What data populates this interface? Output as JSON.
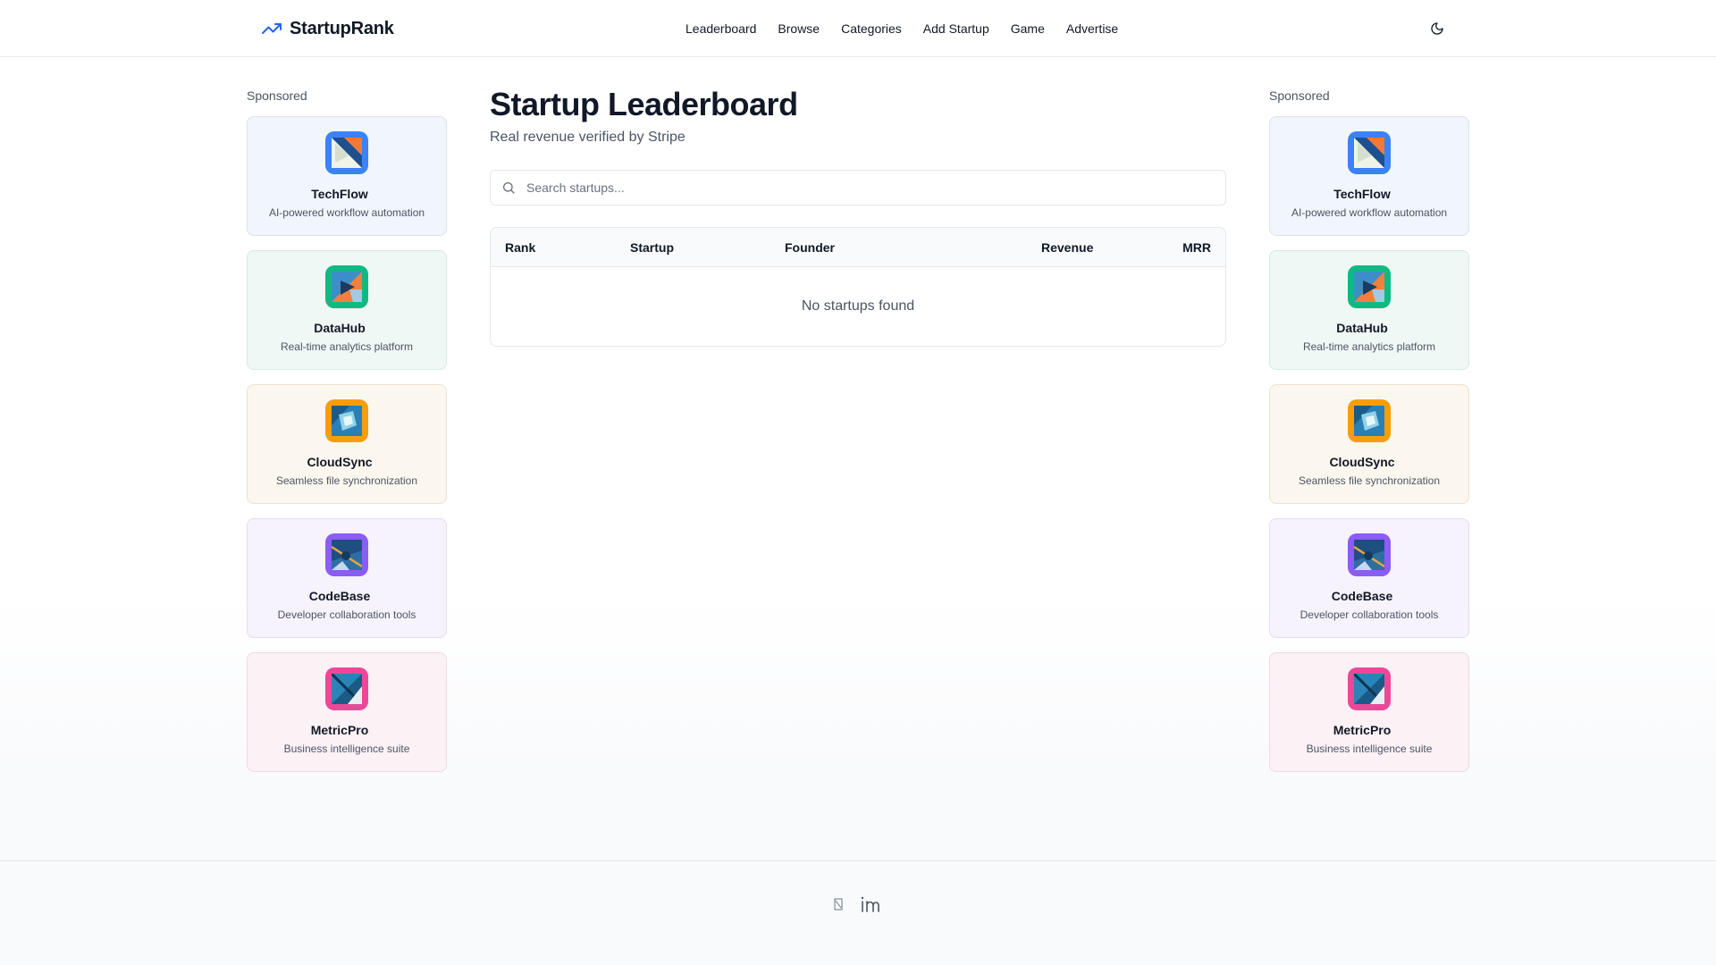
{
  "header": {
    "logo_text": "StartupRank",
    "nav": [
      "Leaderboard",
      "Browse",
      "Categories",
      "Add Startup",
      "Game",
      "Advertise"
    ]
  },
  "sidebar_left": {
    "label": "Sponsored",
    "ads": [
      {
        "name": "TechFlow",
        "desc": "AI-powered workflow automation",
        "icon_color": "#3b82f6"
      },
      {
        "name": "DataHub",
        "desc": "Real-time analytics platform",
        "icon_color": "#10b981"
      },
      {
        "name": "CloudSync",
        "desc": "Seamless file synchronization",
        "icon_color": "#f59e0b"
      },
      {
        "name": "CodeBase",
        "desc": "Developer collaboration tools",
        "icon_color": "#8b5cf6"
      },
      {
        "name": "MetricPro",
        "desc": "Business intelligence suite",
        "icon_color": "#ec4899"
      }
    ]
  },
  "sidebar_right": {
    "label": "Sponsored",
    "ads": [
      {
        "name": "TechFlow",
        "desc": "AI-powered workflow automation",
        "icon_color": "#3b82f6"
      },
      {
        "name": "DataHub",
        "desc": "Real-time analytics platform",
        "icon_color": "#10b981"
      },
      {
        "name": "CloudSync",
        "desc": "Seamless file synchronization",
        "icon_color": "#f59e0b"
      },
      {
        "name": "CodeBase",
        "desc": "Developer collaboration tools",
        "icon_color": "#8b5cf6"
      },
      {
        "name": "MetricPro",
        "desc": "Business intelligence suite",
        "icon_color": "#ec4899"
      }
    ]
  },
  "main": {
    "title": "Startup Leaderboard",
    "subtitle": "Real revenue verified by Stripe",
    "search_placeholder": "Search startups...",
    "table": {
      "columns": [
        "Rank",
        "Startup",
        "Founder",
        "Revenue",
        "MRR"
      ],
      "empty_text": "No startups found"
    }
  },
  "footer": {
    "icons": [
      "x-icon",
      "linkedin-icon"
    ]
  },
  "colors": {
    "accent": "#2563eb",
    "text": "#111827",
    "muted": "#4b5563",
    "border": "#e5e7eb"
  }
}
